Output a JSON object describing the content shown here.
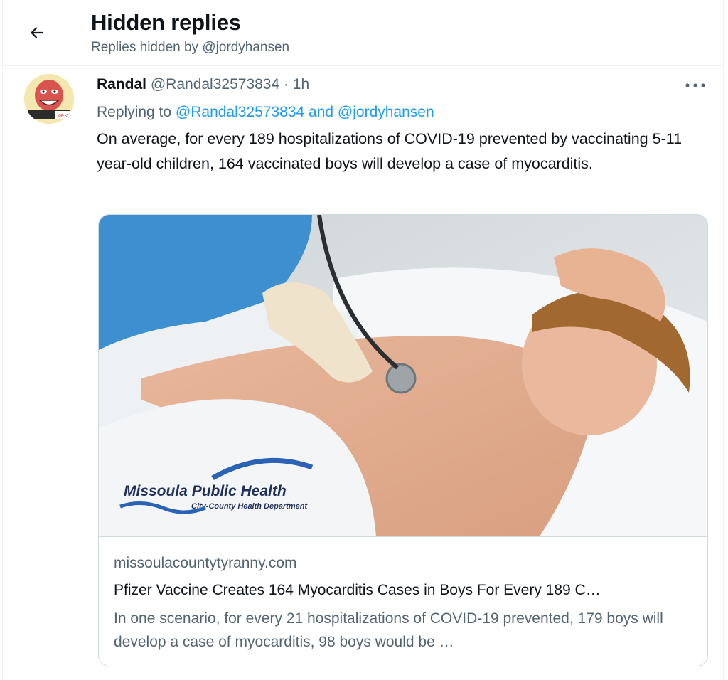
{
  "header": {
    "title": "Hidden replies",
    "subtitle": "Replies hidden by @jordyhansen"
  },
  "tweet": {
    "name": "Randal",
    "handle": "@Randal32573834",
    "separator": "·",
    "time": "1h",
    "replying_prefix": "Replying to ",
    "replying_to": "@Randal32573834 and @jordyhansen",
    "text": "On average, for every 189 hospitalizations of COVID-19 prevented by vaccinating 5-11 year-old children, 164 vaccinated boys will develop a case of myocarditis.",
    "avatar_text": "kek",
    "card": {
      "logo_title": "Missoula Public Health",
      "logo_subtitle": "City-County Health Department",
      "domain": "missoulacountytyranny.com",
      "title": "Pfizer Vaccine Creates 164 Myocarditis Cases in Boys For Every 189 C…",
      "description": "In one scenario, for every 21 hospitalizations of COVID-19 prevented, 179 boys will develop a case of myocarditis, 98 boys would be …"
    }
  },
  "icons": {
    "back": "back-arrow-icon",
    "more": "more-dots-icon"
  },
  "colors": {
    "link": "#1d9bf0",
    "secondary_text": "#536471",
    "border": "#cfd9de"
  }
}
